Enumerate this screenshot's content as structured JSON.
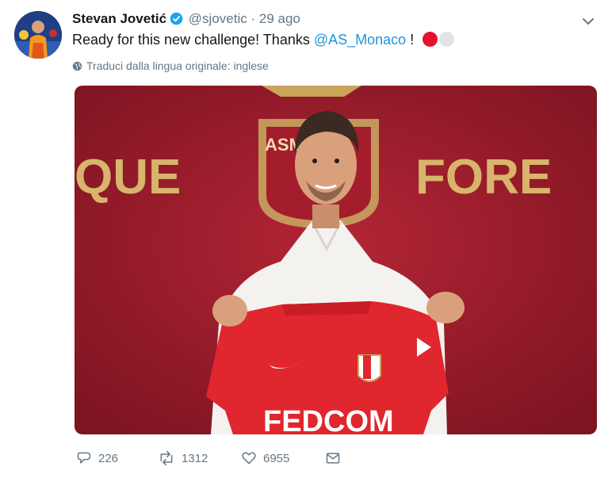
{
  "tweet": {
    "author_name": "Stevan Jovetić",
    "handle": "@sjovetic",
    "separator": "·",
    "time": "29 ago",
    "text_before": "Ready for this new challenge! Thanks ",
    "mention": "@AS_Monaco",
    "text_after": " !",
    "translate_label": "Traduci dalla lingua originale: inglese"
  },
  "media": {
    "wall_text_left": "QUE",
    "wall_text_right": "FORE",
    "crest_text": "ASMO",
    "shirt_sponsor": "FEDCOM",
    "colors": {
      "wall": "#9e1b2a",
      "gold": "#d7b36a",
      "shirt": "#e0262e"
    }
  },
  "actions": {
    "replies": "226",
    "retweets": "1312",
    "likes": "6955"
  },
  "colors": {
    "link": "#1b95e0",
    "muted": "#657786",
    "verified": "#1da1f2",
    "text": "#14171a"
  }
}
